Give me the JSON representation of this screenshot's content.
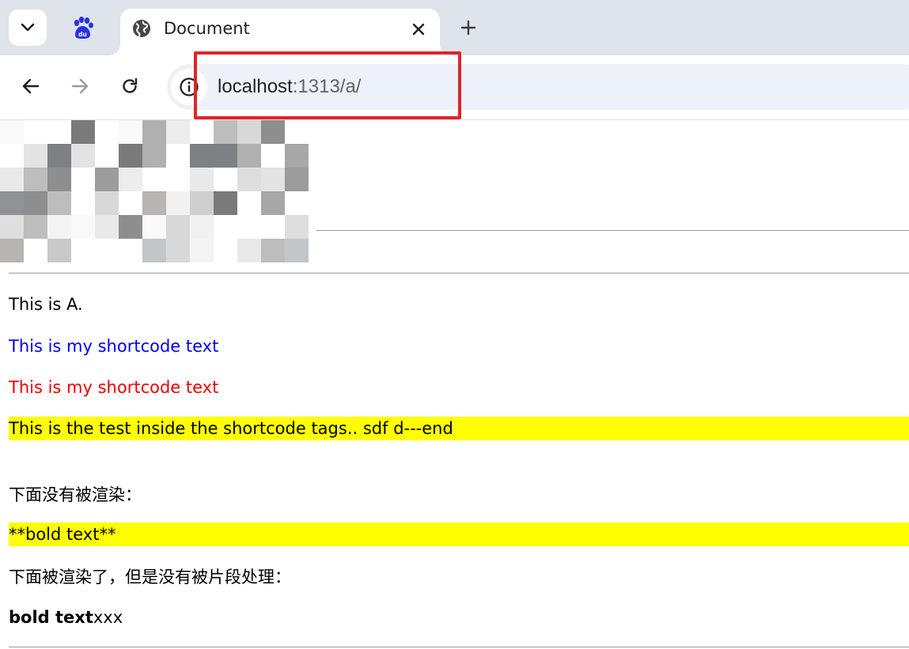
{
  "browser": {
    "tab_menu_icon": "chevron-down-icon",
    "pinned_tab_icon": "baidu-paw-icon",
    "active_tab": {
      "favicon": "globe-icon",
      "title": "Document",
      "close_icon": "close-icon"
    },
    "new_tab_icon": "plus-icon"
  },
  "toolbar": {
    "back_icon": "arrow-left-icon",
    "forward_icon": "arrow-right-icon",
    "reload_icon": "reload-icon",
    "site_info_icon": "info-icon",
    "url": {
      "host": "localhost",
      "rest": ":1313/a/"
    }
  },
  "colors": {
    "highlight_border": "#e0242a",
    "link_blue": "#0000ee",
    "text_red": "#ee0000",
    "mark_yellow": "#ffff00",
    "tabstrip_bg": "#dfe3ea",
    "omnibox_bg": "#edf2fa"
  },
  "content": {
    "line_a": "This is A.",
    "line_blue": "This is my shortcode text",
    "line_red": "This is my shortcode text",
    "line_yellow": "This is the test inside the shortcode tags.. sdf d---end",
    "line_cn1": "下面没有被渲染：",
    "line_bold_raw": "**bold text**",
    "line_cn2": "下面被渲染了，但是没有被片段处理：",
    "bold_part": "bold text",
    "bold_suffix": "xxx"
  }
}
